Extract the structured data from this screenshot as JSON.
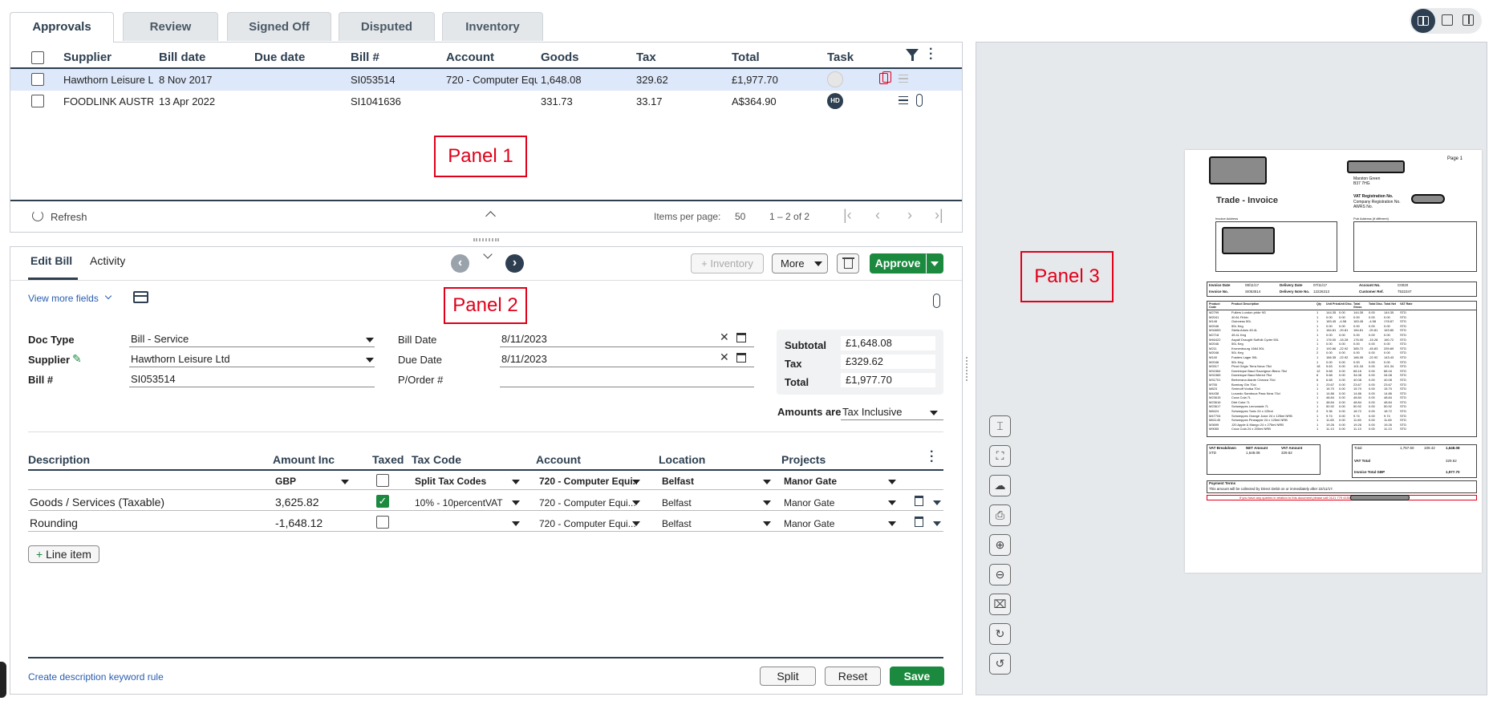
{
  "tabs": [
    "Approvals",
    "Review",
    "Signed Off",
    "Disputed",
    "Inventory"
  ],
  "panel1": {
    "columns": [
      "Supplier",
      "Bill date",
      "Due date",
      "Bill #",
      "Account",
      "Goods",
      "Tax",
      "Total",
      "Task"
    ],
    "rows": [
      {
        "supplier": "Hawthorn Leisure L...",
        "bill_date": "8 Nov 2017",
        "due_date": "",
        "bill_no": "SI053514",
        "account": "720 - Computer Equ...",
        "goods": "1,648.08",
        "tax": "329.62",
        "total": "£1,977.70"
      },
      {
        "supplier": "FOODLINK AUSTRA...",
        "bill_date": "13 Apr 2022",
        "due_date": "",
        "bill_no": "SI1041636",
        "account": "",
        "goods": "331.73",
        "tax": "33.17",
        "total": "A$364.90",
        "task_initials": "HD"
      }
    ],
    "refresh": "Refresh",
    "items_per_page_label": "Items per page:",
    "items_per_page": "50",
    "range": "1 – 2 of 2"
  },
  "annotations": {
    "panel1": "Panel 1",
    "panel2": "Panel 2",
    "panel3": "Panel 3"
  },
  "panel2": {
    "tabs": [
      "Edit Bill",
      "Activity"
    ],
    "inventory_btn": "Inventory",
    "more_btn": "More",
    "approve_btn": "Approve",
    "view_more": "View more fields",
    "doc_type_label": "Doc Type",
    "doc_type": "Bill - Service",
    "supplier_label": "Supplier",
    "supplier": "Hawthorn Leisure Ltd",
    "bill_no_label": "Bill #",
    "bill_no": "SI053514",
    "bill_date_label": "Bill Date",
    "bill_date": "8/11/2023",
    "due_date_label": "Due Date",
    "due_date": "8/11/2023",
    "porder_label": "P/Order #",
    "porder": "",
    "subtotal_label": "Subtotal",
    "subtotal": "£1,648.08",
    "tax_label": "Tax",
    "tax": "£329.62",
    "total_label": "Total",
    "total": "£1,977.70",
    "amounts_are_label": "Amounts are",
    "amounts_are": "Tax Inclusive",
    "line_columns": [
      "Description",
      "Amount Inc",
      "Taxed",
      "Tax Code",
      "Account",
      "Location",
      "Projects"
    ],
    "filter_row": {
      "currency": "GBP",
      "tax_code": "Split Tax Codes",
      "account": "720 - Computer Equi...",
      "location": "Belfast",
      "projects": "Manor Gate"
    },
    "lines": [
      {
        "description": "Goods / Services (Taxable)",
        "amount": "3,625.82",
        "taxed": true,
        "tax_code": "10% - 10percentVAT",
        "account": "720 - Computer Equi...",
        "location": "Belfast",
        "projects": "Manor Gate"
      },
      {
        "description": "Rounding",
        "amount": "-1,648.12",
        "taxed": false,
        "tax_code": "",
        "account": "720 - Computer Equi...",
        "location": "Belfast",
        "projects": "Manor Gate"
      }
    ],
    "line_item_btn": "Line item",
    "keyword_rule": "Create description keyword rule",
    "split_btn": "Split",
    "reset_btn": "Reset",
    "save_btn": "Save"
  },
  "invoice": {
    "page": "Page 1",
    "title": "Trade - Invoice",
    "address_lines": [
      "Marston Green",
      "B37 7HG"
    ],
    "vat_reg": "VAT Registration No.",
    "company_reg": "Company Registration No.",
    "awrs": "AWRS No.",
    "invoice_address": "Invoice Address",
    "pub_address": "Pub Address (if different)",
    "meta1": [
      "Invoice Date",
      "08/11/17",
      "Delivery Date",
      "07/11/17",
      "Account No.",
      "C0020"
    ],
    "meta2": [
      "Invoice No.",
      "SI053514",
      "Delivery Note No.",
      "12226313",
      "Customer Ref.",
      "7532347"
    ],
    "item_headers": [
      "Product Code",
      "Product Description",
      "Qty",
      "Unit Price",
      "Unit Disc.",
      "Total Gross",
      "Total Disc.",
      "Total Net",
      "VAT Rate"
    ],
    "items": [
      [
        "M2799",
        "Fullers London pride 9G",
        "1",
        "144.35",
        "0.00",
        "144.35",
        "0.00",
        "144.35",
        "STD"
      ],
      [
        "M2041",
        "40.6L Firkin",
        "1",
        "0.00",
        "0.00",
        "0.00",
        "0.00",
        "0.00",
        "STD"
      ],
      [
        "M148",
        "Guinness 50L",
        "1",
        "183.45",
        "-4.58",
        "183.45",
        "-4.58",
        "178.87",
        "STD"
      ],
      [
        "M2046",
        "50L Keg",
        "1",
        "0.00",
        "0.00",
        "0.00",
        "0.00",
        "0.00",
        "STD"
      ],
      [
        "M34653",
        "Stella Artois 45.4L",
        "1",
        "184.81",
        "-20.81",
        "184.81",
        "-20.81",
        "163.80",
        "STD"
      ],
      [
        "M2718",
        "45.4L Keg",
        "1",
        "0.00",
        "0.00",
        "0.00",
        "0.00",
        "0.00",
        "STD"
      ],
      [
        "M46422",
        "Aspall Draught Suffolk Cyder 50L",
        "1",
        "176.00",
        "-15.28",
        "176.00",
        "-15.28",
        "160.72",
        "STD"
      ],
      [
        "M2046",
        "50L Keg",
        "1",
        "0.00",
        "0.00",
        "0.00",
        "0.00",
        "0.00",
        "STD"
      ],
      [
        "M211",
        "Kronenbourg 1664 50L",
        "2",
        "192.86",
        "-22.92",
        "385.72",
        "-45.83",
        "339.89",
        "STD"
      ],
      [
        "M2046",
        "50L Keg",
        "2",
        "0.00",
        "0.00",
        "0.00",
        "0.00",
        "0.00",
        "STD"
      ],
      [
        "M140",
        "Fosters Lager 50L",
        "1",
        "166.35",
        "-22.92",
        "166.35",
        "-22.92",
        "143.43",
        "STD"
      ],
      [
        "M2046",
        "50L Keg",
        "1",
        "0.00",
        "0.00",
        "0.00",
        "0.00",
        "0.00",
        "STD"
      ],
      [
        "M3317",
        "Pinot Grigio Terra Nova 75cl",
        "18",
        "5.63",
        "0.00",
        "101.34",
        "0.00",
        "101.34",
        "STD"
      ],
      [
        "M31564",
        "Dominique Baud Sauvignon Blanc 75cl",
        "12",
        "5.68",
        "0.00",
        "68.16",
        "0.00",
        "68.16",
        "STD"
      ],
      [
        "M31565",
        "Dominique Baud Merlot 75cl",
        "6",
        "5.68",
        "0.00",
        "34.08",
        "0.00",
        "34.08",
        "STD"
      ],
      [
        "M31701",
        "Berberana Alarde Crianza 75cl",
        "6",
        "6.68",
        "0.00",
        "40.08",
        "0.00",
        "40.08",
        "STD"
      ],
      [
        "M755",
        "Bombay Gin 70cl",
        "1",
        "23.67",
        "0.00",
        "23.67",
        "0.00",
        "23.67",
        "STD"
      ],
      [
        "M823",
        "Smirnoff Vodka 70cl",
        "1",
        "15.70",
        "0.00",
        "15.70",
        "0.00",
        "15.70",
        "STD"
      ],
      [
        "M4438",
        "Luxardo Sambuca Pass Nera 70cl",
        "1",
        "14.86",
        "0.00",
        "14.86",
        "0.00",
        "14.86",
        "STD"
      ],
      [
        "M23615",
        "Coca Cola 7L",
        "1",
        "48.84",
        "0.00",
        "48.84",
        "0.00",
        "48.84",
        "STD"
      ],
      [
        "M23616",
        "Diet Coke 7L",
        "1",
        "48.84",
        "0.00",
        "48.84",
        "0.00",
        "48.84",
        "STD"
      ],
      [
        "M23617",
        "Schweppes Lemonade 7L",
        "1",
        "50.92",
        "0.00",
        "50.92",
        "0.00",
        "50.92",
        "STD"
      ],
      [
        "M8424",
        "Schweppes Tonic 24 x 125ml",
        "2",
        "9.36",
        "0.00",
        "18.72",
        "0.00",
        "18.72",
        "STD"
      ],
      [
        "M47704",
        "Schweppes Orange Juice 24 x 125ml NRB",
        "1",
        "9.74",
        "0.00",
        "9.74",
        "0.00",
        "9.74",
        "STD"
      ],
      [
        "M61140",
        "Schweppes Pineapple 24 x 125ml NRB",
        "1",
        "11.65",
        "0.00",
        "11.65",
        "0.00",
        "11.65",
        "STD"
      ],
      [
        "M3699",
        "J20 Apple & Mango 24 x 275ml NRB",
        "1",
        "19.26",
        "0.00",
        "19.26",
        "0.00",
        "19.26",
        "STD"
      ],
      [
        "M9065",
        "Coca Cola 24 x 200ml NRB",
        "1",
        "11.13",
        "0.00",
        "11.13",
        "0.00",
        "11.13",
        "STD"
      ]
    ],
    "vat_breakdown_headers": [
      "VAT Breakdown",
      "NET Amount",
      "VAT Amount"
    ],
    "vat_breakdown_row": [
      "STD",
      "1,648.08",
      "329.62"
    ],
    "totals_row": [
      "Total",
      "1,757.50",
      "109.42",
      "1,648.08"
    ],
    "vat_total_label": "VAT Total",
    "vat_total": "329.62",
    "invoice_total_label": "Invoice Total GBP",
    "invoice_total": "1,977.70",
    "payment_terms": "Payment Terms",
    "payment_text": "This amount will be collected by Direct Debit on or immediately after 22/11/17.",
    "queries_text": "If you have any queries in relation to this document please call 0121 779 4150 or email"
  },
  "colors": {
    "accent": "#2d3f50",
    "green": "#1b8a3f",
    "selected_row": "#dde8fa",
    "annotation": "#e0001a"
  }
}
